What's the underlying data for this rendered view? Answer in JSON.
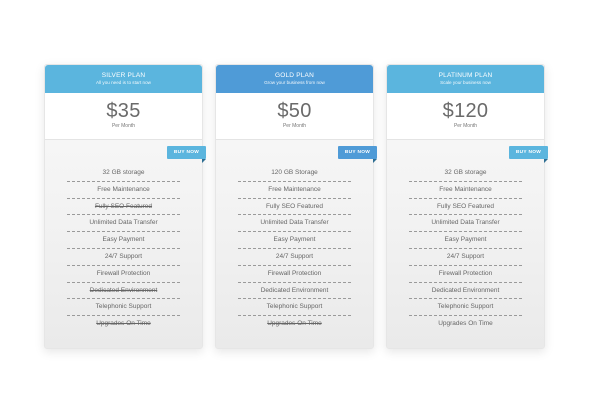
{
  "plans": [
    {
      "name": "SILVER PLAN",
      "tagline": "All you need is to start now",
      "price": "$35",
      "period": "Per Month",
      "buy_label": "BUY NOW",
      "features": [
        {
          "label": "32 GB storage",
          "included": true
        },
        {
          "label": "Free Maintenance",
          "included": true
        },
        {
          "label": "Fully SEO Featured",
          "included": false
        },
        {
          "label": "Unlimited Data Transfer",
          "included": true
        },
        {
          "label": "Easy Payment",
          "included": true
        },
        {
          "label": "24/7 Support",
          "included": true
        },
        {
          "label": "Firewall Protection",
          "included": true
        },
        {
          "label": "Dedicated Environment",
          "included": false
        },
        {
          "label": "Telephonic Support",
          "included": true
        },
        {
          "label": "Upgrades On Time",
          "included": false
        }
      ]
    },
    {
      "name": "GOLD PLAN",
      "tagline": "Grow your business from now",
      "price": "$50",
      "period": "Per Month",
      "buy_label": "BUY NOW",
      "features": [
        {
          "label": "120 GB Storage",
          "included": true
        },
        {
          "label": "Free Maintenance",
          "included": true
        },
        {
          "label": "Fully SEO Featured",
          "included": true
        },
        {
          "label": "Unlimited Data Transfer",
          "included": true
        },
        {
          "label": "Easy Payment",
          "included": true
        },
        {
          "label": "24/7 Support",
          "included": true
        },
        {
          "label": "Firewall Protection",
          "included": true
        },
        {
          "label": "Dedicated Environment",
          "included": true
        },
        {
          "label": "Telephonic Support",
          "included": true
        },
        {
          "label": "Upgrades On Time",
          "included": false
        }
      ]
    },
    {
      "name": "PLATINUM PLAN",
      "tagline": "Scale your business now",
      "price": "$120",
      "period": "Per Month",
      "buy_label": "BUY NOW",
      "features": [
        {
          "label": "32 GB storage",
          "included": true
        },
        {
          "label": "Free Maintenance",
          "included": true
        },
        {
          "label": "Fully SEO Featured",
          "included": true
        },
        {
          "label": "Unlimited Data Transfer",
          "included": true
        },
        {
          "label": "Easy Payment",
          "included": true
        },
        {
          "label": "24/7 Support",
          "included": true
        },
        {
          "label": "Firewall Protection",
          "included": true
        },
        {
          "label": "Dedicated Environment",
          "included": true
        },
        {
          "label": "Telephonic Support",
          "included": true
        },
        {
          "label": "Upgrades On Time",
          "included": true
        }
      ]
    }
  ],
  "colors": {
    "header_light_blue": "#5bb5de",
    "header_gold_blue": "#4f9bd7",
    "button_fold_shadow": "#2e6e92"
  }
}
